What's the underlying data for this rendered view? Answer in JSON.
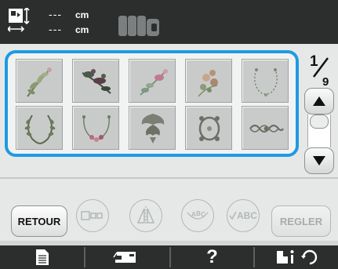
{
  "header": {
    "width_value": "---",
    "width_unit": "cm",
    "height_value": "---",
    "height_unit": "cm",
    "icons": [
      "pattern-size-icon",
      "thread-spools-icon"
    ]
  },
  "pattern_grid": {
    "tiles": [
      {
        "name": "leafy-branch-pattern"
      },
      {
        "name": "flower-spray-pattern"
      },
      {
        "name": "floral-sprig-pattern"
      },
      {
        "name": "flower-cluster-pattern"
      },
      {
        "name": "dotted-wreath-pattern"
      },
      {
        "name": "laurel-wreath-pattern"
      },
      {
        "name": "floral-arch-pattern"
      },
      {
        "name": "damask-ornament-pattern"
      },
      {
        "name": "ornamental-frame-pattern"
      },
      {
        "name": "scroll-border-pattern"
      }
    ]
  },
  "pagination": {
    "current": "1",
    "total": "9"
  },
  "buttons": {
    "retour": "RETOUR",
    "regler": "REGLER",
    "abc_check": "ABC"
  },
  "colors": {
    "accent": "#1e9be0",
    "dark_bar": "#2c2e2e",
    "panel": "#e6e8e8",
    "tile": "#c9cbcb",
    "disabled": "#a7abab"
  },
  "toolbar": {
    "help": "?",
    "icons": [
      "document-icon",
      "sewing-machine-icon",
      "help-icon",
      "presser-foot-info-icon"
    ]
  }
}
